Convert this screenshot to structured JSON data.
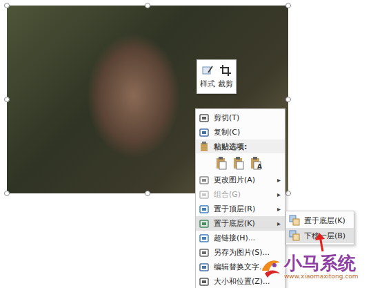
{
  "photo": {
    "selected": true
  },
  "mini_toolbar": {
    "buttons": [
      {
        "label": "样式"
      },
      {
        "label": "裁剪"
      }
    ]
  },
  "context_menu": {
    "submenu_arrow": "▸",
    "items": [
      {
        "kind": "item",
        "label": "剪切(T)",
        "disabled": false,
        "highlighted": false,
        "has_submenu": false
      },
      {
        "kind": "item",
        "label": "复制(C)",
        "disabled": false,
        "highlighted": false,
        "has_submenu": false
      },
      {
        "kind": "header",
        "label": "粘贴选项:",
        "disabled": false,
        "highlighted": false,
        "has_submenu": false
      },
      {
        "kind": "paste-icons",
        "text_glyph": "A",
        "count": 3,
        "disabled": false,
        "highlighted": false,
        "has_submenu": false
      },
      {
        "kind": "item",
        "label": "更改图片(A)",
        "disabled": false,
        "highlighted": false,
        "has_submenu": true
      },
      {
        "kind": "item",
        "label": "组合(G)",
        "disabled": true,
        "highlighted": false,
        "has_submenu": true
      },
      {
        "kind": "item",
        "label": "置于顶层(R)",
        "disabled": false,
        "highlighted": false,
        "has_submenu": true
      },
      {
        "kind": "item",
        "label": "置于底层(K)",
        "disabled": false,
        "highlighted": true,
        "has_submenu": true
      },
      {
        "kind": "item",
        "label": "超链接(H)...",
        "disabled": false,
        "highlighted": false,
        "has_submenu": false
      },
      {
        "kind": "item",
        "label": "另存为图片(S)...",
        "disabled": false,
        "highlighted": false,
        "has_submenu": false
      },
      {
        "kind": "item",
        "label": "编辑替换文字...",
        "disabled": false,
        "highlighted": false,
        "has_submenu": false
      },
      {
        "kind": "item",
        "label": "大小和位置(Z)...",
        "disabled": false,
        "highlighted": false,
        "has_submenu": false
      }
    ]
  },
  "submenu": {
    "items": [
      {
        "label": "置于底层(K)",
        "highlighted": false
      },
      {
        "label": "下移一层(B)",
        "highlighted": true
      }
    ]
  },
  "watermark": {
    "title": "小马系统",
    "url": "www.xiaomaxitong.com"
  }
}
